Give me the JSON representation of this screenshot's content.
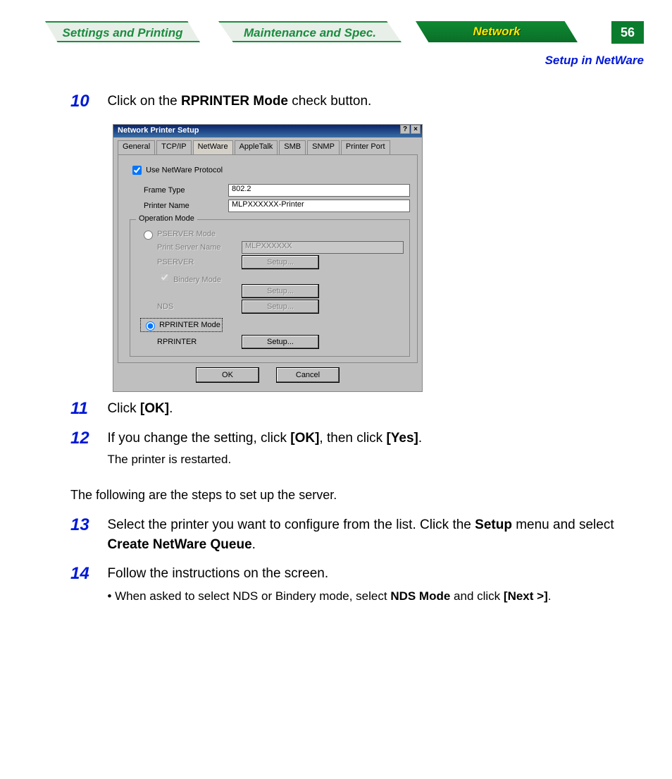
{
  "nav": {
    "tab1": "Settings and Printing",
    "tab2": "Maintenance and Spec.",
    "tab3": "Network",
    "page_number": "56",
    "subhead": "Setup in NetWare"
  },
  "steps": {
    "s10": {
      "num": "10",
      "text_pre": "Click on the ",
      "text_bold": "RPRINTER Mode",
      "text_post": " check button."
    },
    "s11": {
      "num": "11",
      "text_pre": "Click ",
      "text_bold": "[OK]",
      "text_post": "."
    },
    "s12": {
      "num": "12",
      "text_pre": "If you change the setting, click ",
      "text_bold1": "[OK]",
      "text_mid": ", then click ",
      "text_bold2": "[Yes]",
      "text_post": ".",
      "note": "The printer is restarted."
    },
    "intro": "The following are the steps to set up the server.",
    "s13": {
      "num": "13",
      "text_pre": "Select the printer you want to configure from the list. Click the ",
      "text_bold1": "Setup",
      "text_mid": " menu and select ",
      "text_bold2": "Create NetWare Queue",
      "text_post": "."
    },
    "s14": {
      "num": "14",
      "text": "Follow the instructions on the screen.",
      "bullet_pre": "• When asked to select NDS or Bindery mode, select ",
      "bullet_b1": "NDS Mode",
      "bullet_mid": " and click ",
      "bullet_b2": "[Next >]",
      "bullet_post": "."
    }
  },
  "dialog": {
    "title": "Network Printer Setup",
    "help_btn": "?",
    "close_btn": "×",
    "tabs": {
      "general": "General",
      "tcpip": "TCP/IP",
      "netware": "NetWare",
      "appletalk": "AppleTalk",
      "smb": "SMB",
      "snmp": "SNMP",
      "printerport": "Printer Port"
    },
    "use_netware": "Use NetWare Protocol",
    "frame_type_lbl": "Frame Type",
    "frame_type_val": "802.2",
    "printer_name_lbl": "Printer Name",
    "printer_name_val": "MLPXXXXXX-Printer",
    "operation_mode": "Operation Mode",
    "pserver_mode": "PSERVER Mode",
    "print_server_name_lbl": "Print Server Name",
    "print_server_name_val": "MLPXXXXXX",
    "pserver_lbl": "PSERVER",
    "bindery_mode": "Bindery Mode",
    "nds_lbl": "NDS",
    "rprinter_mode": "RPRINTER Mode",
    "rprinter_lbl": "RPRINTER",
    "setup_btn": "Setup...",
    "ok": "OK",
    "cancel": "Cancel"
  }
}
